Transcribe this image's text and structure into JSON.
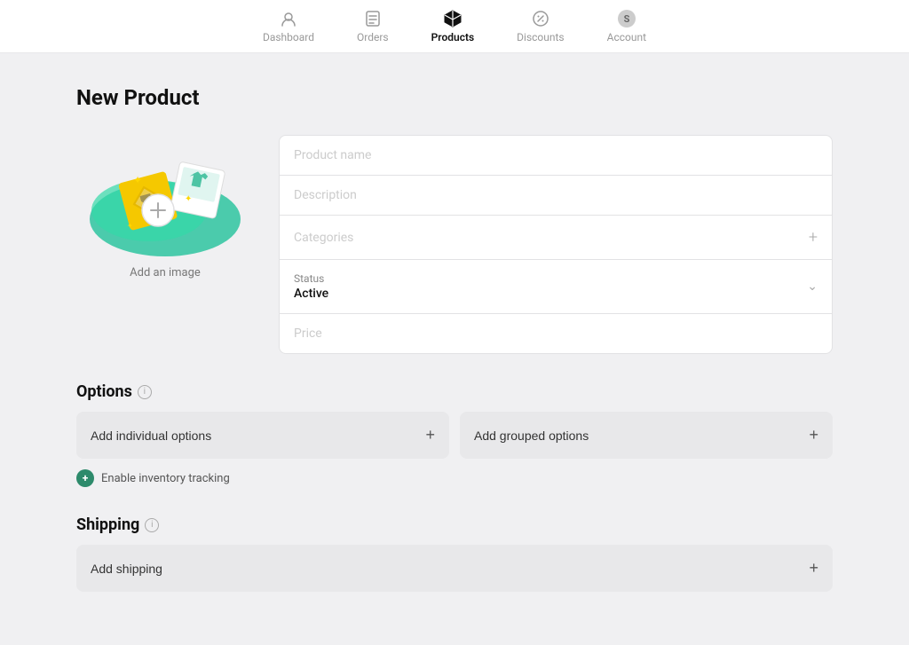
{
  "nav": {
    "items": [
      {
        "id": "dashboard",
        "label": "Dashboard",
        "active": false
      },
      {
        "id": "orders",
        "label": "Orders",
        "active": false
      },
      {
        "id": "products",
        "label": "Products",
        "active": true
      },
      {
        "id": "discounts",
        "label": "Discounts",
        "active": false
      },
      {
        "id": "account",
        "label": "Account",
        "active": false
      }
    ]
  },
  "page": {
    "title": "New Product"
  },
  "image_upload": {
    "label": "Add an image"
  },
  "form": {
    "product_name_placeholder": "Product name",
    "description_placeholder": "Description",
    "categories_placeholder": "Categories",
    "status_label": "Status",
    "status_value": "Active",
    "price_placeholder": "Price"
  },
  "options_section": {
    "title": "Options",
    "add_individual_label": "Add individual options",
    "add_grouped_label": "Add grouped options",
    "inventory_text": "Enable inventory tracking"
  },
  "shipping_section": {
    "title": "Shipping",
    "add_shipping_label": "Add shipping"
  },
  "icons": {
    "plus": "+",
    "chevron_down": "⌄",
    "info": "i"
  }
}
